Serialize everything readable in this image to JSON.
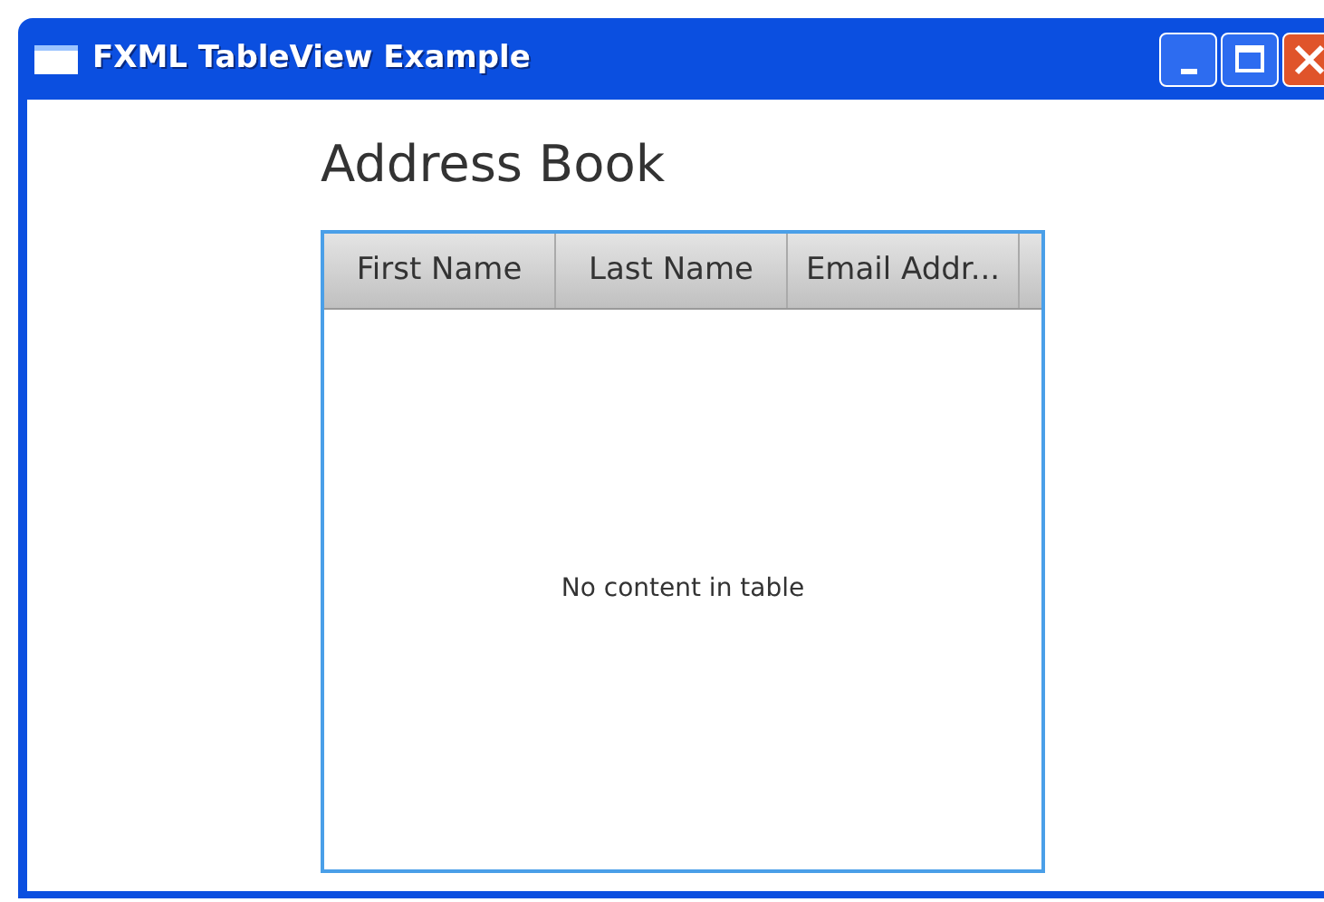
{
  "window": {
    "title": "FXML TableView Example"
  },
  "heading": "Address Book",
  "table": {
    "columns": [
      "First Name",
      "Last Name",
      "Email Addr..."
    ],
    "placeholder": "No content in table"
  }
}
